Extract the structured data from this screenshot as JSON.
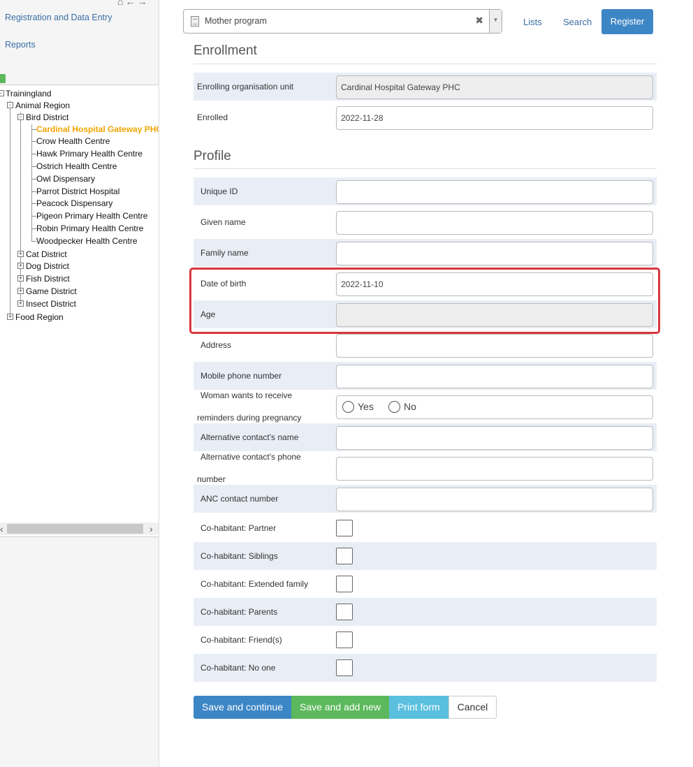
{
  "sidebar": {
    "links": [
      "Registration and Data Entry",
      "Reports"
    ],
    "tree": [
      {
        "label": "Trainingland",
        "expander": "-"
      },
      {
        "label": "Animal Region",
        "expander": "-"
      },
      {
        "label": "Bird District",
        "expander": "-"
      },
      {
        "label": "Cardinal Hospital Gateway PHC",
        "selected": true
      },
      {
        "label": "Crow Health Centre"
      },
      {
        "label": "Hawk Primary Health Centre"
      },
      {
        "label": "Ostrich Health Centre"
      },
      {
        "label": "Owl Dispensary"
      },
      {
        "label": "Parrot District Hospital"
      },
      {
        "label": "Peacock Dispensary"
      },
      {
        "label": "Pigeon Primary Health Centre"
      },
      {
        "label": "Robin Primary Health Centre"
      },
      {
        "label": "Woodpecker Health Centre"
      },
      {
        "label": "Cat District",
        "expander": "+"
      },
      {
        "label": "Dog District",
        "expander": "+"
      },
      {
        "label": "Fish District",
        "expander": "+"
      },
      {
        "label": "Game District",
        "expander": "+"
      },
      {
        "label": "Insect District",
        "expander": "+"
      },
      {
        "label": "Food Region",
        "expander": "+"
      }
    ]
  },
  "program_select": {
    "value": "Mother program"
  },
  "nav": {
    "lists": "Lists",
    "search": "Search",
    "register": "Register"
  },
  "enrollment": {
    "title": "Enrollment",
    "fields": [
      {
        "label": "Enrolling organisation unit",
        "value": "Cardinal Hospital Gateway PHC",
        "readonly": true
      },
      {
        "label": "Enrolled",
        "value": "2022-11-28"
      }
    ]
  },
  "profile": {
    "title": "Profile",
    "fields": [
      {
        "label": "Unique ID",
        "value": ""
      },
      {
        "label": "Given name",
        "value": ""
      },
      {
        "label": "Family name",
        "value": ""
      },
      {
        "label": "Date of birth",
        "value": "2022-11-10"
      },
      {
        "label": "Age",
        "value": "",
        "readonly": true
      },
      {
        "label": "Address",
        "value": ""
      },
      {
        "label": "Mobile phone number",
        "value": ""
      },
      {
        "label": "Woman wants to receive reminders during pregnancy",
        "label_lines": [
          "Woman wants to receive",
          "reminders during pregnancy"
        ],
        "options": [
          "Yes",
          "No"
        ]
      },
      {
        "label": "Alternative contact's name",
        "value": ""
      },
      {
        "label": "Alternative contact's phone number",
        "label_lines": [
          "Alternative contact's phone",
          "number"
        ],
        "value": ""
      },
      {
        "label": "ANC contact number",
        "value": ""
      }
    ],
    "checkboxes": [
      "Co-habitant: Partner",
      "Co-habitant: Siblings",
      "Co-habitant: Extended family",
      "Co-habitant: Parents",
      "Co-habitant: Friend(s)",
      "Co-habitant: No one"
    ]
  },
  "actions": {
    "save_continue": "Save and continue",
    "save_new": "Save and add new",
    "print": "Print form",
    "cancel": "Cancel"
  }
}
